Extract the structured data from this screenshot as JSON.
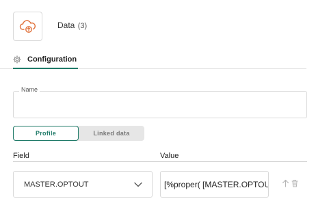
{
  "node": {
    "icon": "cloud-sync-icon",
    "title": "Data",
    "count": "(3)"
  },
  "tabs": [
    {
      "label": "Configuration",
      "icon": "gear-icon",
      "active": true
    }
  ],
  "name_field": {
    "label": "Name",
    "value": ""
  },
  "segmented": {
    "options": [
      "Profile",
      "Linked data"
    ],
    "selected": "Profile"
  },
  "mapping": {
    "headers": {
      "field": "Field",
      "value": "Value"
    },
    "rows": [
      {
        "field": "MASTER.OPTOUT",
        "value": "[%proper( [MASTER.OPTOUT"
      }
    ]
  },
  "colors": {
    "accent": "#1f7a68",
    "brand_icon": "#e0703a"
  }
}
